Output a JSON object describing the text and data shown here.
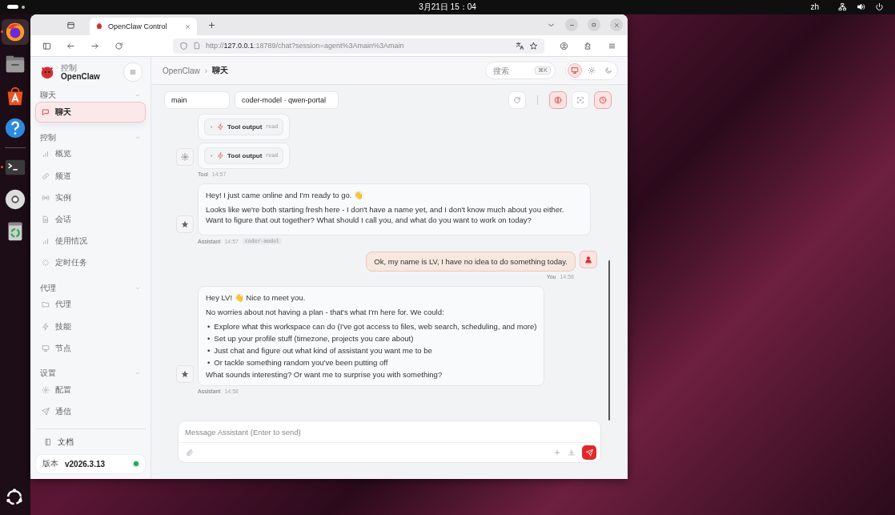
{
  "top_bar": {
    "clock": "3月21日 15：04",
    "input_language": "zh"
  },
  "dock": {
    "apps": [
      {
        "kind": "firefox",
        "running": true
      },
      {
        "kind": "files",
        "running": false
      },
      {
        "kind": "appcenter",
        "running": false
      },
      {
        "kind": "help",
        "running": false
      },
      {
        "kind": "terminal",
        "running": true
      },
      {
        "kind": "disc",
        "running": false
      },
      {
        "kind": "trash",
        "running": false
      }
    ]
  },
  "browser": {
    "tab_title": "OpenClaw Control",
    "url_scheme": "http://",
    "url_host": "127.0.0.1",
    "url_path": ":18789/chat?session=agent%3Amain%3Amain"
  },
  "sidebar": {
    "brand_caption": "控制",
    "brand_name": "OpenClaw",
    "groups": [
      {
        "label": "聊天",
        "items": [
          {
            "label": "聊天",
            "kind": "chat",
            "selected": true
          }
        ]
      },
      {
        "label": "控制",
        "items": [
          {
            "label": "概览",
            "kind": "bars",
            "selected": false
          },
          {
            "label": "频道",
            "kind": "link",
            "selected": false
          },
          {
            "label": "实例",
            "kind": "radio",
            "selected": false
          },
          {
            "label": "会话",
            "kind": "doc",
            "selected": false
          },
          {
            "label": "使用情况",
            "kind": "bars",
            "selected": false
          },
          {
            "label": "定时任务",
            "kind": "loader",
            "selected": false
          }
        ]
      },
      {
        "label": "代理",
        "items": [
          {
            "label": "代理",
            "kind": "folder",
            "selected": false
          },
          {
            "label": "技能",
            "kind": "bolt",
            "selected": false
          },
          {
            "label": "节点",
            "kind": "monitor",
            "selected": false
          }
        ]
      },
      {
        "label": "设置",
        "items": [
          {
            "label": "配置",
            "kind": "gear",
            "selected": false
          },
          {
            "label": "通信",
            "kind": "send",
            "selected": false
          }
        ]
      }
    ],
    "docs_link": "文档",
    "version_label": "版本",
    "version": "v2026.3.13"
  },
  "header": {
    "breadcrumb": [
      "OpenClaw",
      "聊天"
    ],
    "breadcrumb_separator": "›",
    "search": {
      "placeholder": "搜索",
      "shortcut": "⌘K"
    },
    "theme_buttons": [
      {
        "kind": "system",
        "selected": true
      },
      {
        "kind": "light",
        "selected": false
      },
      {
        "kind": "dark",
        "selected": false
      }
    ]
  },
  "toolbar": {
    "session": "main",
    "model": "coder-model · qwen-portal",
    "actions": [
      {
        "kind": "refresh",
        "on": false
      },
      {
        "kind": "thinking",
        "on": true
      },
      {
        "kind": "focus",
        "on": false
      },
      {
        "kind": "cron",
        "on": true
      }
    ]
  },
  "messages": [
    {
      "kind": "tool",
      "sender": "Tool",
      "time": "14:57",
      "tools": [
        {
          "label": "Tool output",
          "name": "read"
        },
        {
          "label": "Tool output",
          "name": "read"
        }
      ]
    },
    {
      "kind": "assistant",
      "sender": "Assistant",
      "time": "14:57",
      "model": "coder-model",
      "blocks": [
        {
          "kind": "p",
          "text": "Hey! I just came online and I'm ready to go. 👋"
        },
        {
          "kind": "p",
          "text": "Looks like we're both starting fresh here - I don't have a name yet, and I don't know much about you either. Want to figure that out together? What should I call you, and what do you want to work on today?"
        }
      ]
    },
    {
      "kind": "user",
      "sender": "You",
      "time": "14:58",
      "text": "Ok, my name is LV, I have no idea to do something today."
    },
    {
      "kind": "assistant",
      "sender": "Assistant",
      "time": "14:58",
      "blocks": [
        {
          "kind": "p",
          "text": "Hey LV! 👋 Nice to meet you."
        },
        {
          "kind": "p",
          "text": "No worries about not having a plan - that's what I'm here for. We could:"
        },
        {
          "kind": "ul",
          "bullet": "•",
          "items": [
            "Explore what this workspace can do (I've got access to files, web search, scheduling, and more)",
            "Set up your profile stuff (timezone, projects you care about)",
            "Just chat and figure out what kind of assistant you want me to be",
            "Or tackle something random you've been putting off"
          ]
        },
        {
          "kind": "tail",
          "text": "What sounds interesting? Or want me to surprise you with something?"
        }
      ]
    }
  ],
  "composer": {
    "placeholder": "Message Assistant (Enter to send)"
  }
}
